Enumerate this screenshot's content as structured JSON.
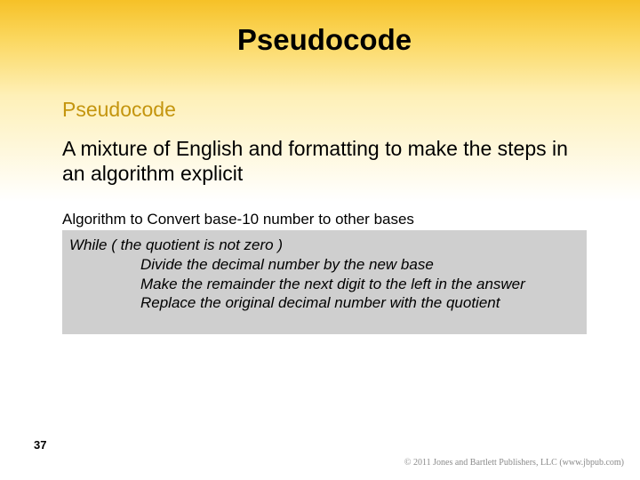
{
  "title": "Pseudocode",
  "subheading": "Pseudocode",
  "body": "A mixture of English and formatting to make the steps in an algorithm explicit",
  "algo_label": "Algorithm to Convert base-10 number to other bases",
  "code": {
    "l1": "While ( the quotient is not zero )",
    "l2": "Divide the decimal number by the new base",
    "l3": "Make the remainder the next digit to the left in the answer",
    "l4": "Replace the original decimal number with the quotient"
  },
  "page_number": "37",
  "copyright": "© 2011 Jones and Bartlett Publishers, LLC (www.jbpub.com)"
}
